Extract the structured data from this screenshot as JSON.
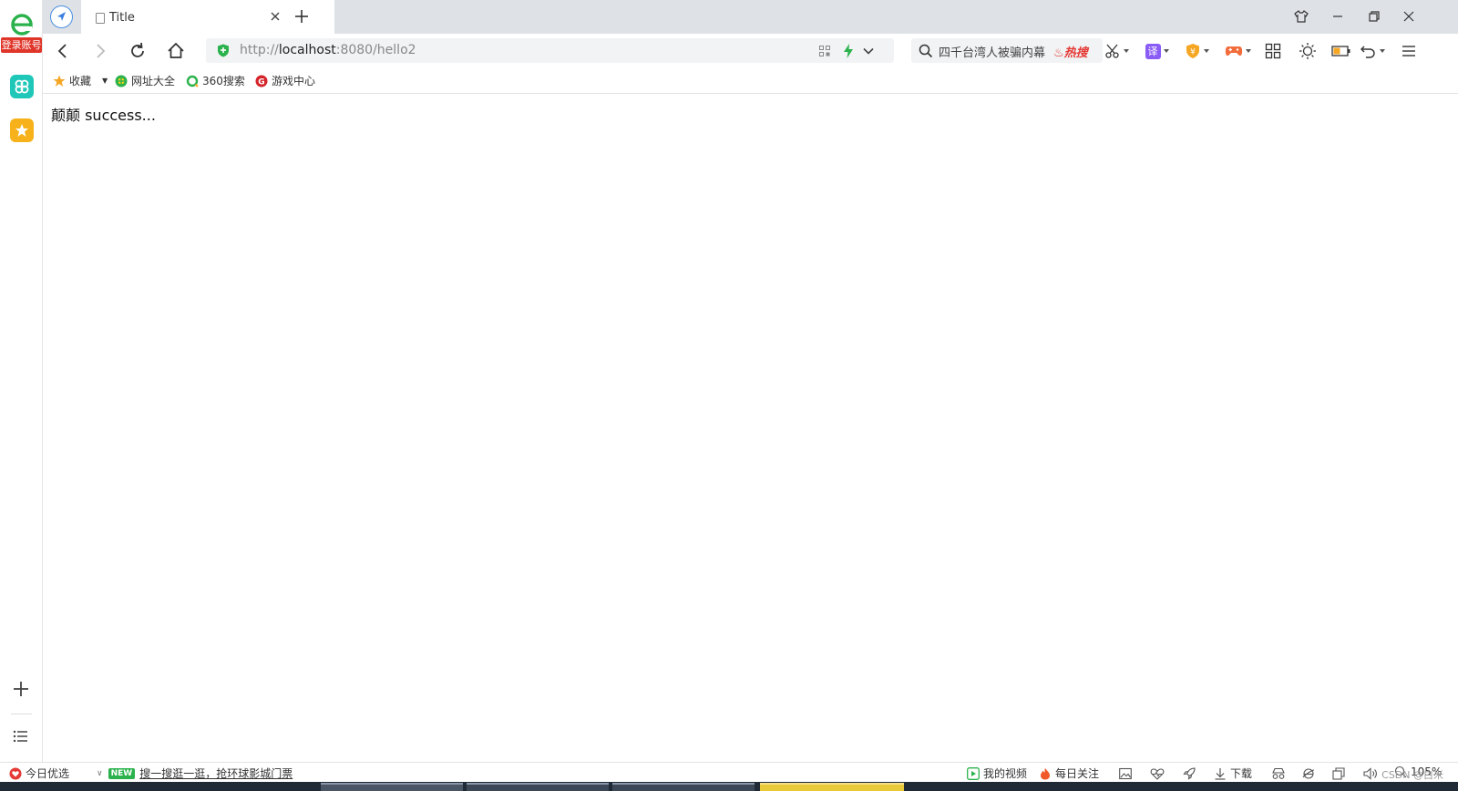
{
  "sidebar": {
    "login_label": "登录账号"
  },
  "tab": {
    "title": "Title"
  },
  "address": {
    "url_scheme": "http://",
    "url_host": "localhost",
    "url_rest": ":8080/hello2"
  },
  "search": {
    "text": "四千台湾人被骗内幕",
    "hot_label": "热搜"
  },
  "bookmarks": [
    {
      "label": "收藏"
    },
    {
      "label": "网址大全"
    },
    {
      "label": "360搜索"
    },
    {
      "label": "游戏中心"
    }
  ],
  "page": {
    "text": "颠颠 success..."
  },
  "status": {
    "today": "今日优选",
    "new_badge": "NEW",
    "news": "搜一搜逛一逛，抢环球影城门票",
    "my_video": "我的视频",
    "daily_follow": "每日关注",
    "download": "下载",
    "zoom": "105%",
    "watermark": "CSDN @白米"
  },
  "colors": {
    "accent_green": "#2bb24c",
    "hot_red": "#e53935",
    "login_red": "#e0362a"
  }
}
